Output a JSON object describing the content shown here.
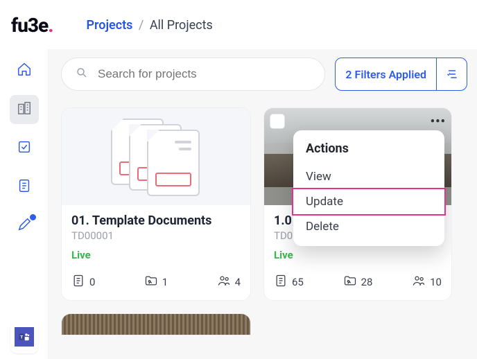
{
  "logo": {
    "text": "fu3e",
    "dot": "."
  },
  "breadcrumb": {
    "root": "Projects",
    "current": "All Projects"
  },
  "search": {
    "placeholder": "Search for projects"
  },
  "filters": {
    "label": "2 Filters Applied"
  },
  "actions_menu": {
    "title": "Actions",
    "items": [
      "View",
      "Update",
      "Delete"
    ],
    "highlighted_index": 1
  },
  "cards": [
    {
      "title": "01. Template Documents",
      "code": "TD00001",
      "status": "Live",
      "stats": {
        "docs": "0",
        "folders": "1",
        "people": "4"
      }
    },
    {
      "title": "1.0",
      "code": "TD00001",
      "status": "Live",
      "stats": {
        "docs": "65",
        "folders": "28",
        "people": "10"
      }
    }
  ]
}
